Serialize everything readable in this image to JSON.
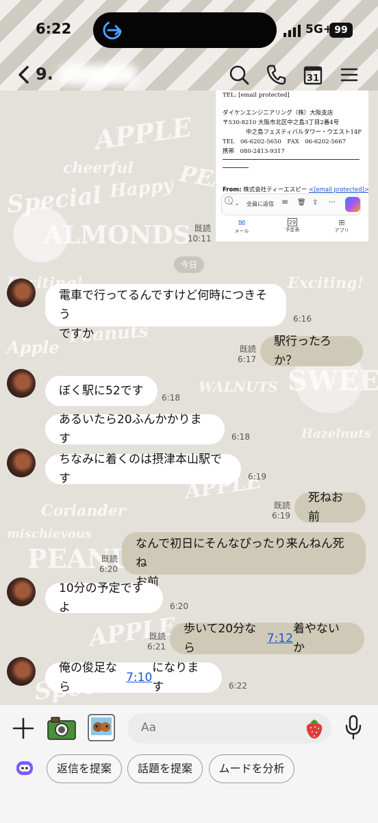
{
  "status": {
    "time": "6:22",
    "network": "5G+",
    "battery": "99"
  },
  "header": {
    "chat_name": "9."
  },
  "shared_image": {
    "line1": "TEL: [email protected]",
    "company": "ダイケンエンジニアリング（株）大阪支店",
    "address1": "〒530-8210 大阪市北区中之島3丁目2番4号",
    "address2": "中之島フェスティバルタワー・ウエスト14F",
    "tel_fax": "TEL　06-6202-5650　FAX　06-6202-5667",
    "mobile": "携帯　080-2413-9317",
    "from_label": "From:",
    "from_name": "株式会社ティーエスピー",
    "from_email": "<[email protected]>",
    "reply_all": "全員に返信",
    "tab_mail": "メール",
    "tab_calendar": "予定表",
    "tab_apps": "アプリ",
    "calendar_day": "29",
    "read": "既読",
    "time": "10:11"
  },
  "date_divider": "今日",
  "messages": [
    {
      "text": "電車で行ってるんですけど何時につきそうですか",
      "line1": "電車で行ってるんですけど何時につきそう",
      "line2": "ですか",
      "time": "6:16"
    },
    {
      "text": "駅行ったろか？",
      "read": "既読",
      "time": "6:17"
    },
    {
      "text": "ぼく駅に52です",
      "time": "6:18"
    },
    {
      "text": "あるいたら20ふんかかります",
      "time": "6:18"
    },
    {
      "text": "ちなみに着くのは摂津本山駅です",
      "time": "6:19"
    },
    {
      "text": "死ねお前",
      "read": "既読",
      "time": "6:19"
    },
    {
      "line1": "なんで初日にそんなぴったり来んねん死ね",
      "line2": "お前",
      "read": "既読",
      "time": "6:20"
    },
    {
      "text": "10分の予定ですよ",
      "time": "6:20"
    },
    {
      "pre": "歩いて20分なら",
      "link": "7:12",
      "post": "着やないか",
      "read": "既読",
      "time": "6:21"
    },
    {
      "pre": "俺の俊足なら",
      "link": "7:10",
      "post": "になります",
      "time": "6:22"
    }
  ],
  "input": {
    "placeholder": "Aa"
  },
  "suggestions": [
    "返信を提案",
    "話題を提案",
    "ムードを分析"
  ],
  "colors": {
    "outgoing_bubble": "#cfcab8",
    "incoming_bubble": "#ffffff",
    "link": "#1a56c9"
  }
}
